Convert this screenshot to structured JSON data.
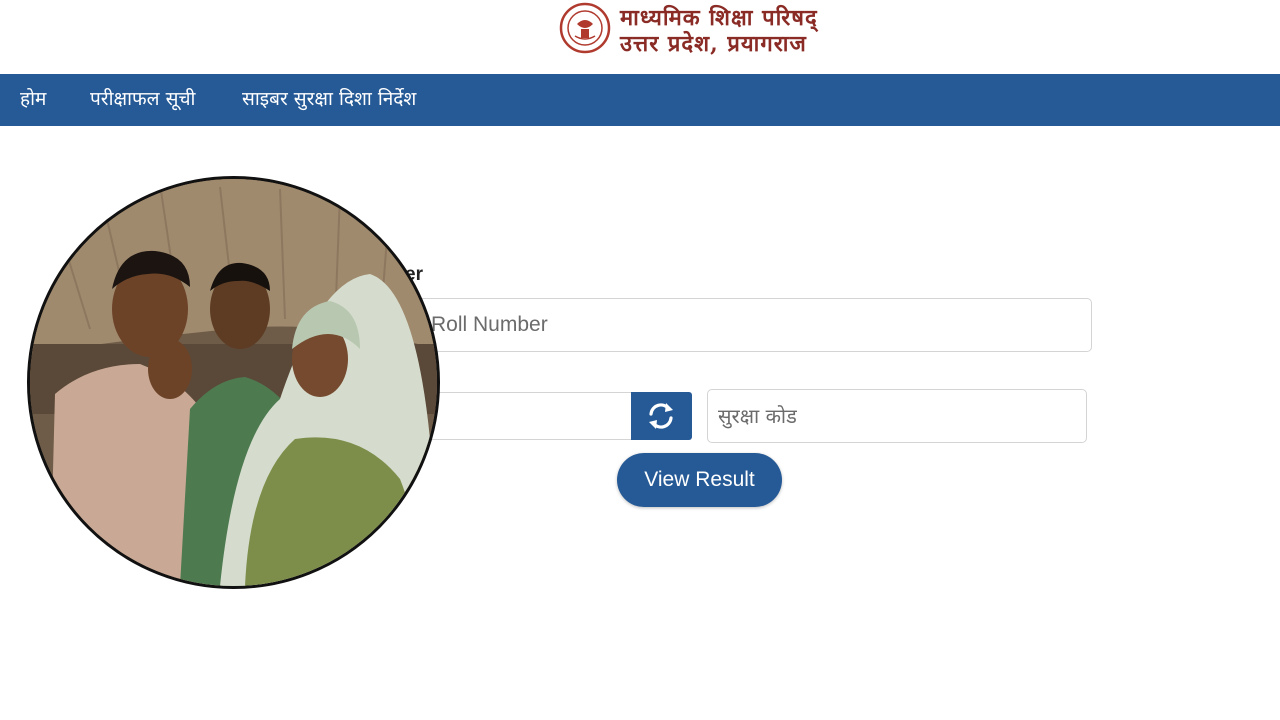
{
  "header": {
    "org_name_line1": "माध्यमिक शिक्षा परिषद्",
    "org_name_line2": "उत्तर प्रदेश, प्रयागराज",
    "logo_icon": "up-emblem-icon"
  },
  "navbar": {
    "items": [
      {
        "label": "होम"
      },
      {
        "label": "परीक्षाफल सूची"
      },
      {
        "label": "साइबर सुरक्षा दिशा निर्देश"
      }
    ]
  },
  "form": {
    "roll_label": "er",
    "roll_input": {
      "value": "",
      "placeholder": "Roll Number"
    },
    "captcha_input": {
      "value": "",
      "placeholder": "सुरक्षा कोड"
    },
    "refresh_icon": "refresh-icon",
    "submit_label": "View Result"
  },
  "colors": {
    "primary": "#265a96",
    "brand_text": "#8a2b25"
  },
  "overlay": {
    "photo_icon": "people-photo"
  }
}
